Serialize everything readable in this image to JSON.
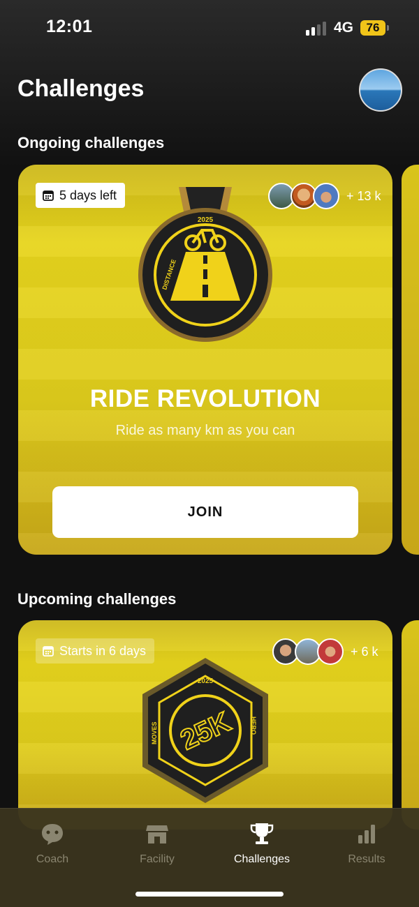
{
  "status_bar": {
    "time": "12:01",
    "network": "4G",
    "battery": "76"
  },
  "header": {
    "title": "Challenges"
  },
  "sections": {
    "ongoing": {
      "title": "Ongoing challenges"
    },
    "upcoming": {
      "title": "Upcoming challenges"
    }
  },
  "ongoing_card": {
    "badge": "5 days left",
    "participants_more": "+ 13 k",
    "medal": {
      "year": "2025",
      "label": "DISTANCE"
    },
    "title": "RIDE REVOLUTION",
    "subtitle": "Ride as many km as you can",
    "join_label": "JOIN"
  },
  "upcoming_card": {
    "badge": "Starts in 6 days",
    "participants_more": "+ 6 k",
    "medal": {
      "year": "2025",
      "big": "25K",
      "left": "MOVES",
      "right": "HERO"
    }
  },
  "tabs": [
    {
      "label": "Coach",
      "icon": "chat-bubble-icon",
      "active": false
    },
    {
      "label": "Facility",
      "icon": "storefront-icon",
      "active": false
    },
    {
      "label": "Challenges",
      "icon": "trophy-icon",
      "active": true
    },
    {
      "label": "Results",
      "icon": "bar-chart-icon",
      "active": false
    }
  ],
  "colors": {
    "accent": "#f0c419",
    "card": "#e2cf1c",
    "background": "#111111"
  }
}
